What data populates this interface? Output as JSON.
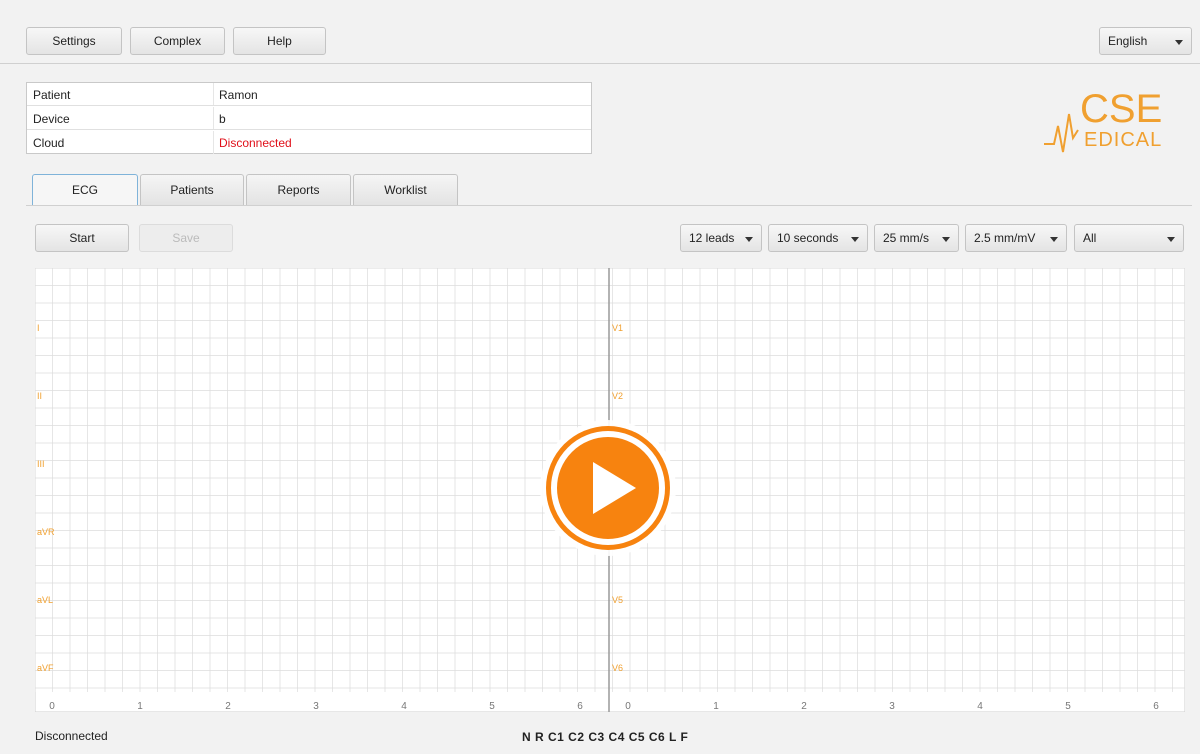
{
  "toolbar": {
    "settings": "Settings",
    "complex": "Complex",
    "help": "Help",
    "language": "English"
  },
  "info": {
    "rows": [
      {
        "key": "Patient",
        "value": "Ramon"
      },
      {
        "key": "Device",
        "value": "b"
      },
      {
        "key": "Cloud",
        "value": "Disconnected"
      }
    ],
    "disconnected_color": "#e0101a"
  },
  "logo": {
    "text_top": "CSE",
    "text_bottom": "EDICAL",
    "color": "#f0a030"
  },
  "tabs": [
    {
      "label": "ECG",
      "active": true
    },
    {
      "label": "Patients",
      "active": false
    },
    {
      "label": "Reports",
      "active": false
    },
    {
      "label": "Worklist",
      "active": false
    }
  ],
  "controls": {
    "start": "Start",
    "save": "Save",
    "leads": "12 leads",
    "duration": "10 seconds",
    "speed": "25 mm/s",
    "gain": "2.5 mm/mV",
    "filter": "All"
  },
  "ecg": {
    "left_leads": [
      "I",
      "II",
      "III",
      "aVR",
      "aVL",
      "aVF"
    ],
    "right_leads": [
      "V1",
      "V2",
      "V3",
      "V4",
      "V5",
      "V6"
    ],
    "x_ticks": [
      "0",
      "1",
      "2",
      "3",
      "4",
      "5",
      "6"
    ],
    "grid_color": "#dcdcdc",
    "label_color": "#f0a030"
  },
  "status": {
    "text": "Disconnected",
    "electrodes": "N R C1 C2 C3 C4 C5 C6 L F"
  },
  "overlay": {
    "play_icon": "play-icon",
    "color": "#f7830f"
  }
}
